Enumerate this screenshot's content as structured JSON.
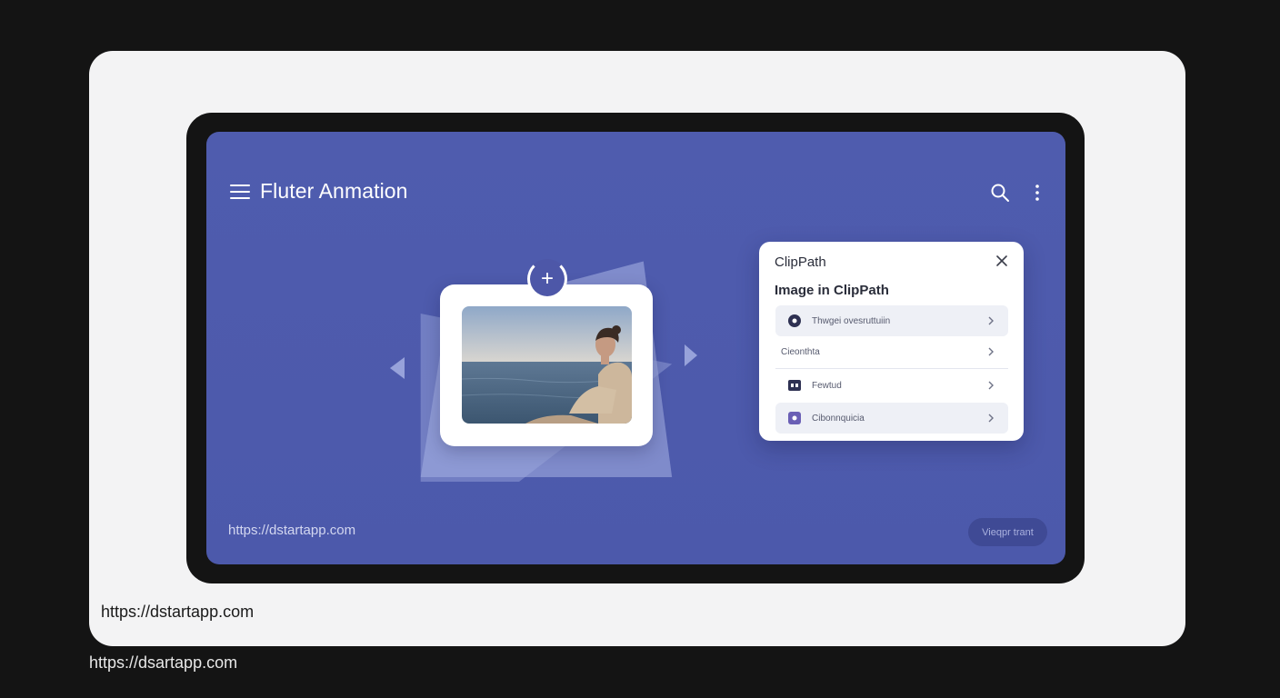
{
  "app": {
    "title": "Fluter Anmation"
  },
  "icons": {
    "menu": "hamburger-menu-icon",
    "search": "search-icon",
    "more": "more-vertical-icon",
    "add": "plus-icon",
    "close": "close-icon",
    "prev": "chevron-left-icon",
    "next": "chevron-right-icon"
  },
  "carousel": {
    "add_label": "+"
  },
  "panel": {
    "title": "ClipPath",
    "subtitle": "Image in ClipPath",
    "items": [
      {
        "label": "Thwgei ovesruttuiin",
        "icon": "circle-icon"
      },
      {
        "label": "Cieonthta",
        "icon": ""
      },
      {
        "label": "Fewtud",
        "icon": "card-icon"
      },
      {
        "label": "Cibonnquicia",
        "icon": "square-icon"
      }
    ]
  },
  "footer": {
    "screen_url": "https://dstartapp.com",
    "button_label": "Vieqpr trant",
    "card_url": "https://dstartapp.com",
    "page_url": "https://dsartapp.com"
  },
  "colors": {
    "screen": "#4f5cae",
    "accent": "#4d57a8",
    "card": "#f3f3f4",
    "background": "#141414"
  }
}
